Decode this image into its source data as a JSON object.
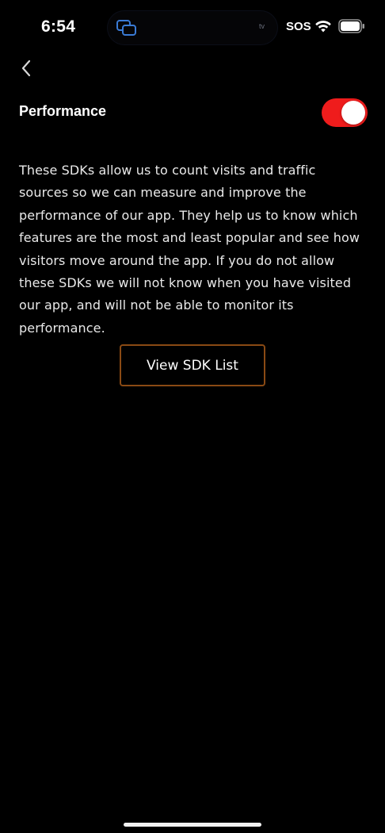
{
  "status_bar": {
    "time": "6:54",
    "island_label": "tv",
    "sos": "SOS",
    "icons": [
      "screen-mirroring-icon",
      "wifi-icon",
      "battery-icon"
    ]
  },
  "nav": {
    "back_icon": "chevron-left-icon"
  },
  "setting": {
    "title": "Performance",
    "enabled": true,
    "toggle_color": "#ef1c1c",
    "description": "These SDKs allow us to count visits and traffic sources so we can measure and improve the performance of our app. They help us to know which features are the most and least popular and see how visitors move around the app. If you do not allow these SDKs we will not know when you have visited our app, and will not be able to monitor its performance."
  },
  "actions": {
    "view_sdk_list_label": "View SDK List",
    "button_border_color": "#8a4a14"
  }
}
